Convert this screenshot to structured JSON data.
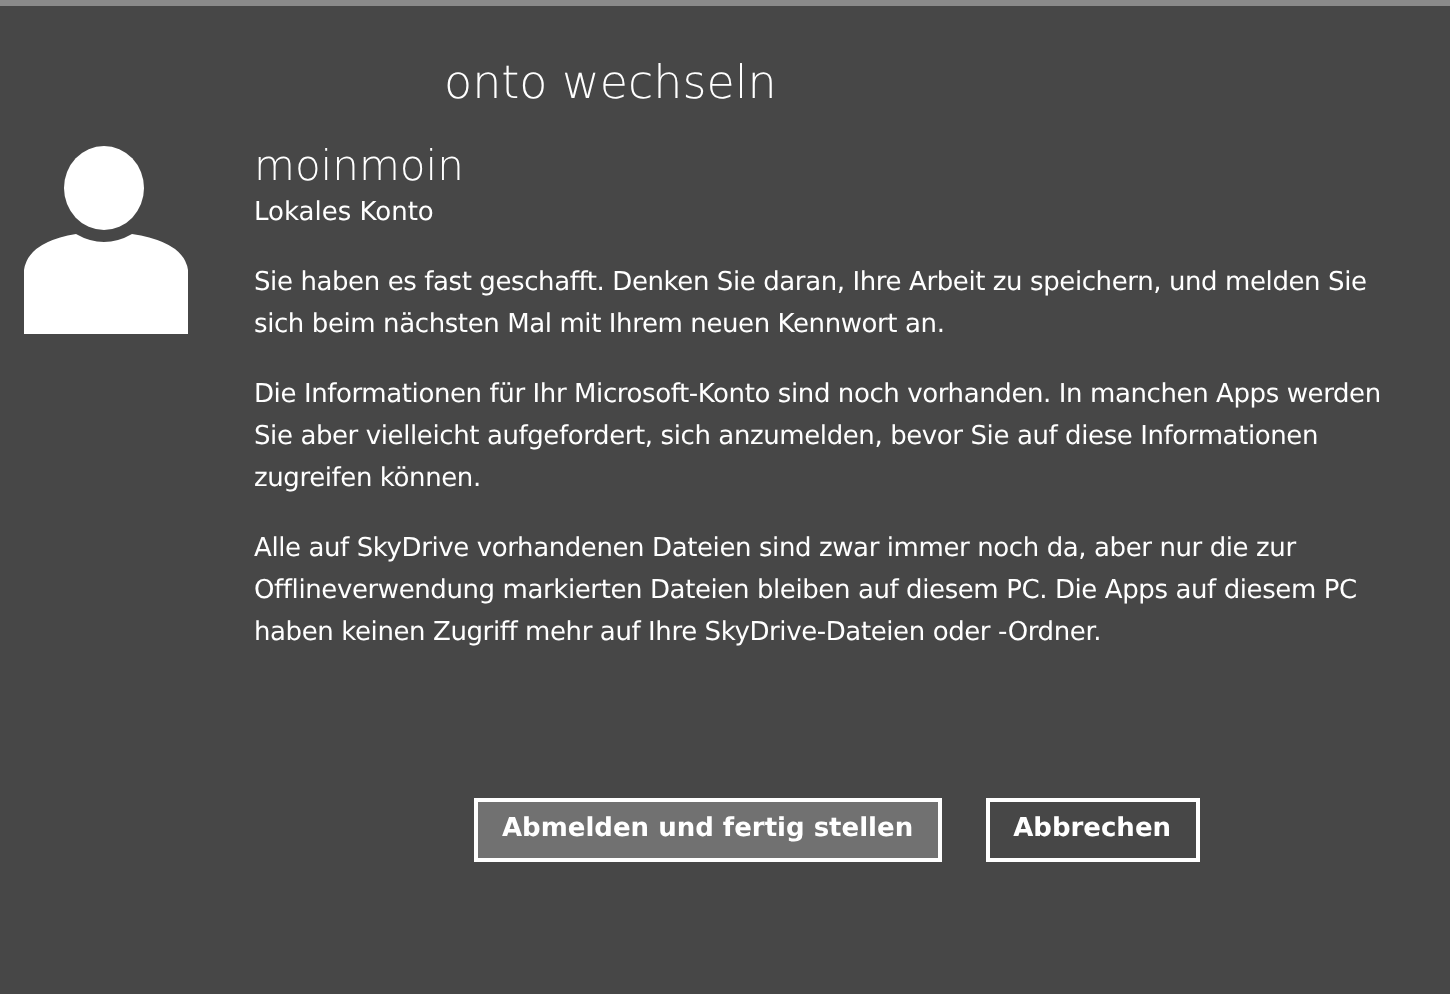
{
  "title": "onto wechseln",
  "account": {
    "name": "moinmoin",
    "type": "Lokales Konto"
  },
  "paragraphs": [
    "Sie haben es fast geschafft. Denken Sie daran, Ihre Arbeit zu speichern, und melden Sie sich beim nächsten Mal mit Ihrem neuen Kennwort an.",
    "Die Informationen für Ihr Microsoft-Konto sind noch vorhanden. In manchen Apps werden Sie aber vielleicht aufgefordert, sich anzumelden, bevor Sie auf diese Informationen zugreifen können.",
    "Alle auf SkyDrive vorhandenen Dateien sind zwar immer noch da, aber nur die zur Offlineverwendung markierten Dateien bleiben auf diesem PC. Die Apps auf diesem PC haben keinen Zugriff mehr auf Ihre SkyDrive-Dateien oder -Ordner."
  ],
  "buttons": [
    {
      "label": "Abmelden und fertig stellen",
      "kind": "primary"
    },
    {
      "label": "Abbrechen",
      "kind": "secondary"
    }
  ]
}
